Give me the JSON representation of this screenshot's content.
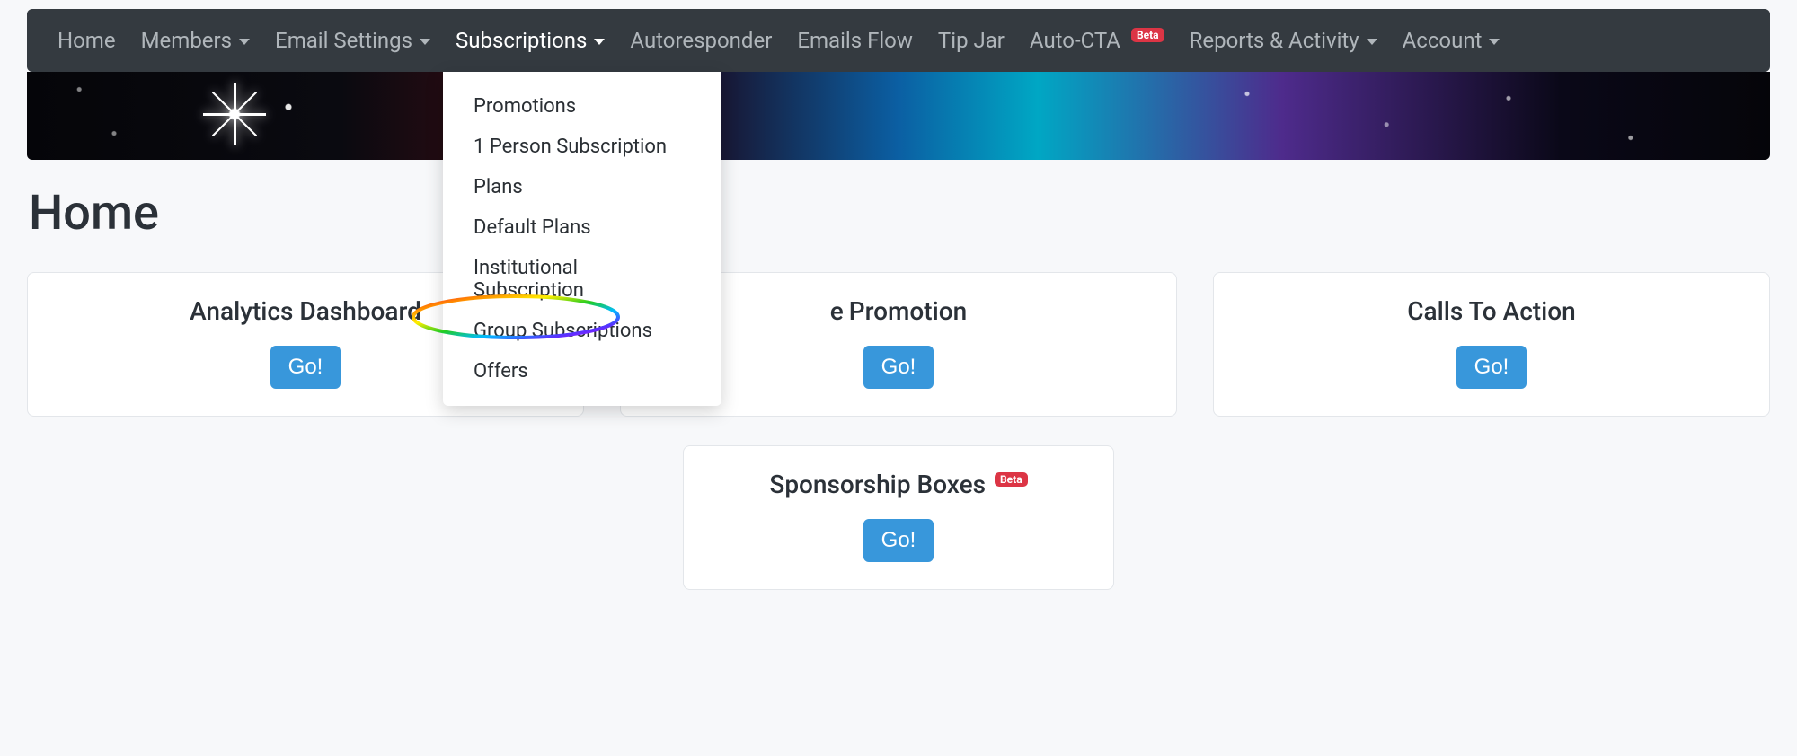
{
  "nav": {
    "items": [
      {
        "label": "Home",
        "dropdown": false
      },
      {
        "label": "Members",
        "dropdown": true
      },
      {
        "label": "Email Settings",
        "dropdown": true
      },
      {
        "label": "Subscriptions",
        "dropdown": true,
        "active": true
      },
      {
        "label": "Autoresponder",
        "dropdown": false
      },
      {
        "label": "Emails Flow",
        "dropdown": false
      },
      {
        "label": "Tip Jar",
        "dropdown": false
      },
      {
        "label": "Auto-CTA",
        "dropdown": false,
        "badge": "Beta"
      },
      {
        "label": "Reports & Activity",
        "dropdown": true
      },
      {
        "label": "Account",
        "dropdown": true
      }
    ]
  },
  "subscriptions_menu": {
    "items": [
      "Promotions",
      "1 Person Subscription",
      "Plans",
      "Default Plans",
      "Institutional Subscription",
      "Group Subscriptions",
      "Offers"
    ],
    "highlighted_index": 5
  },
  "page": {
    "title": "Home"
  },
  "cards": {
    "row1": [
      {
        "title": "Analytics Dashboard",
        "button": "Go!"
      },
      {
        "title": "Promotion",
        "button": "Go!",
        "title_cut_prefix": "e "
      },
      {
        "title": "Calls To Action",
        "button": "Go!"
      }
    ],
    "row2": [
      {
        "title": "Sponsorship Boxes",
        "button": "Go!",
        "badge": "Beta"
      }
    ]
  },
  "annotation": {
    "highlight_target": "Group Subscriptions"
  }
}
